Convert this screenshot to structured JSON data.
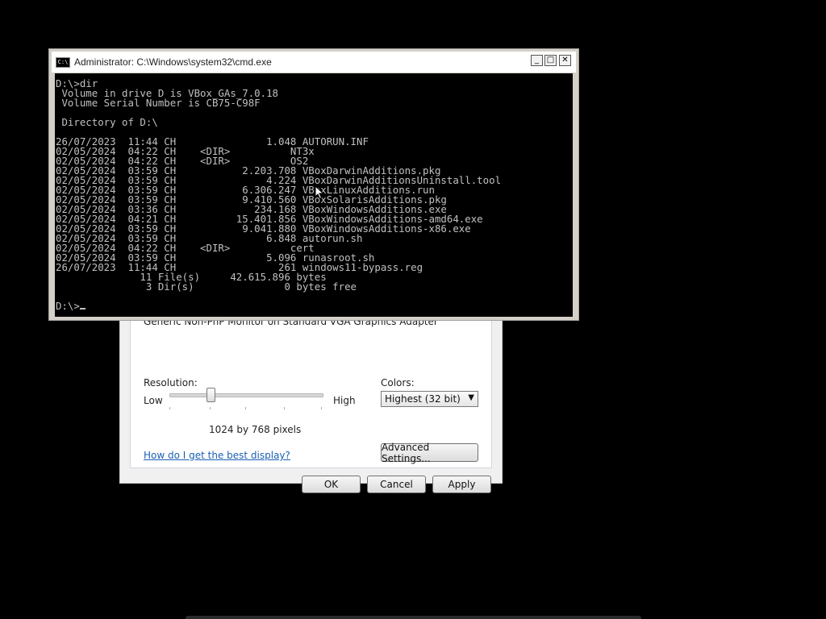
{
  "display_dialog": {
    "monitor": "Generic Non-PnP Monitor on Standard VGA Graphics Adapter",
    "resolution_label": "Resolution:",
    "low_label": "Low",
    "high_label": "High",
    "resolution_value": "1024 by 768 pixels",
    "resolution_slider_fraction": 0.27,
    "colors_label": "Colors:",
    "colors_selected": "Highest (32 bit)",
    "help_link": "How do I get the best display?",
    "advanced_button": "Advanced Settings...",
    "ok_button": "OK",
    "cancel_button": "Cancel",
    "apply_button": "Apply"
  },
  "cmd": {
    "title": "Administrator: C:\\Windows\\system32\\cmd.exe",
    "icon_text": "C:\\",
    "minimize_label": "_",
    "maximize_label": "□",
    "close_label": "✕",
    "lines": [
      "D:\\>dir",
      " Volume in drive D is VBox_GAs_7.0.18",
      " Volume Serial Number is CB75-C98F",
      "",
      " Directory of D:\\",
      "",
      "26/07/2023  11:44 CH               1.048 AUTORUN.INF",
      "02/05/2024  04:22 CH    <DIR>          NT3x",
      "02/05/2024  04:22 CH    <DIR>          OS2",
      "02/05/2024  03:59 CH           2.203.708 VBoxDarwinAdditions.pkg",
      "02/05/2024  03:59 CH               4.224 VBoxDarwinAdditionsUninstall.tool",
      "02/05/2024  03:59 CH           6.306.247 VBoxLinuxAdditions.run",
      "02/05/2024  03:59 CH           9.410.560 VBoxSolarisAdditions.pkg",
      "02/05/2024  03:36 CH             234.168 VBoxWindowsAdditions.exe",
      "02/05/2024  04:21 CH          15.401.856 VBoxWindowsAdditions-amd64.exe",
      "02/05/2024  03:59 CH           9.041.880 VBoxWindowsAdditions-x86.exe",
      "02/05/2024  03:59 CH               6.848 autorun.sh",
      "02/05/2024  04:22 CH    <DIR>          cert",
      "02/05/2024  03:59 CH               5.096 runasroot.sh",
      "26/07/2023  11:44 CH                 261 windows11-bypass.reg",
      "              11 File(s)     42.615.896 bytes",
      "               3 Dir(s)               0 bytes free",
      ""
    ],
    "prompt": "D:\\>"
  }
}
